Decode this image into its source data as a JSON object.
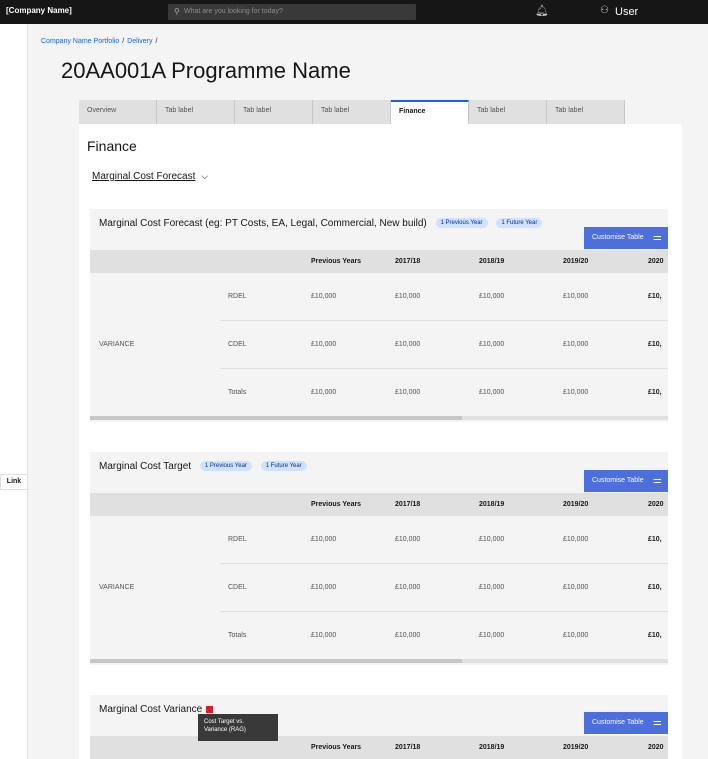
{
  "header": {
    "brand": "[Company Name]",
    "search_placeholder": "What are you looking for today?",
    "user_label": "User"
  },
  "rail": {
    "link_label": "Link"
  },
  "breadcrumb": {
    "items": [
      "Company Name Portfolio",
      "Delivery"
    ],
    "sep": "/"
  },
  "page": {
    "title": "20AA001A Programme Name"
  },
  "tabs": [
    "Overview",
    "Tab label",
    "Tab label",
    "Tab label",
    "Finance",
    "Tab label",
    "Tab label"
  ],
  "finance": {
    "heading": "Finance",
    "dropdown_label": "Marginal Cost Forecast"
  },
  "table_headers": [
    "Previous Years",
    "2017/18",
    "2018/19",
    "2019/20",
    "2020"
  ],
  "cards": [
    {
      "title": "Marginal Cost Forecast (eg: PT Costs, EA, Legal, Commercial, New build)",
      "tags": [
        "1 Previous Year",
        "1 Future Year"
      ],
      "button": "Customise Table",
      "variance_label": "VARIANCE",
      "rows": [
        {
          "label": "RDEL",
          "values": [
            "£10,000",
            "£10,000",
            "£10,000",
            "£10,000",
            "£10,"
          ]
        },
        {
          "label": "CDEL",
          "values": [
            "£10,000",
            "£10,000",
            "£10,000",
            "£10,000",
            "£10,"
          ]
        },
        {
          "label": "Totals",
          "values": [
            "£10,000",
            "£10,000",
            "£10,000",
            "£10,000",
            "£10,"
          ]
        }
      ]
    },
    {
      "title": "Marginal Cost Target",
      "tags": [
        "1 Previous Year",
        "1 Future Year"
      ],
      "button": "Customise Table",
      "variance_label": "VARIANCE",
      "rows": [
        {
          "label": "RDEL",
          "values": [
            "£10,000",
            "£10,000",
            "£10,000",
            "£10,000",
            "£10,"
          ]
        },
        {
          "label": "CDEL",
          "values": [
            "£10,000",
            "£10,000",
            "£10,000",
            "£10,000",
            "£10,"
          ]
        },
        {
          "label": "Totals",
          "values": [
            "£10,000",
            "£10,000",
            "£10,000",
            "£10,000",
            "£10,"
          ]
        }
      ]
    },
    {
      "title": "Marginal Cost Variance",
      "button": "Customise Table",
      "tooltip_line1": "Cost Target vs.",
      "tooltip_line2": "Variance (RAG)"
    }
  ],
  "colors": {
    "primary": "#0f62fe",
    "button": "#4d6fdb",
    "rag": "#da1e28",
    "tag_bg": "#d0e2ff"
  }
}
